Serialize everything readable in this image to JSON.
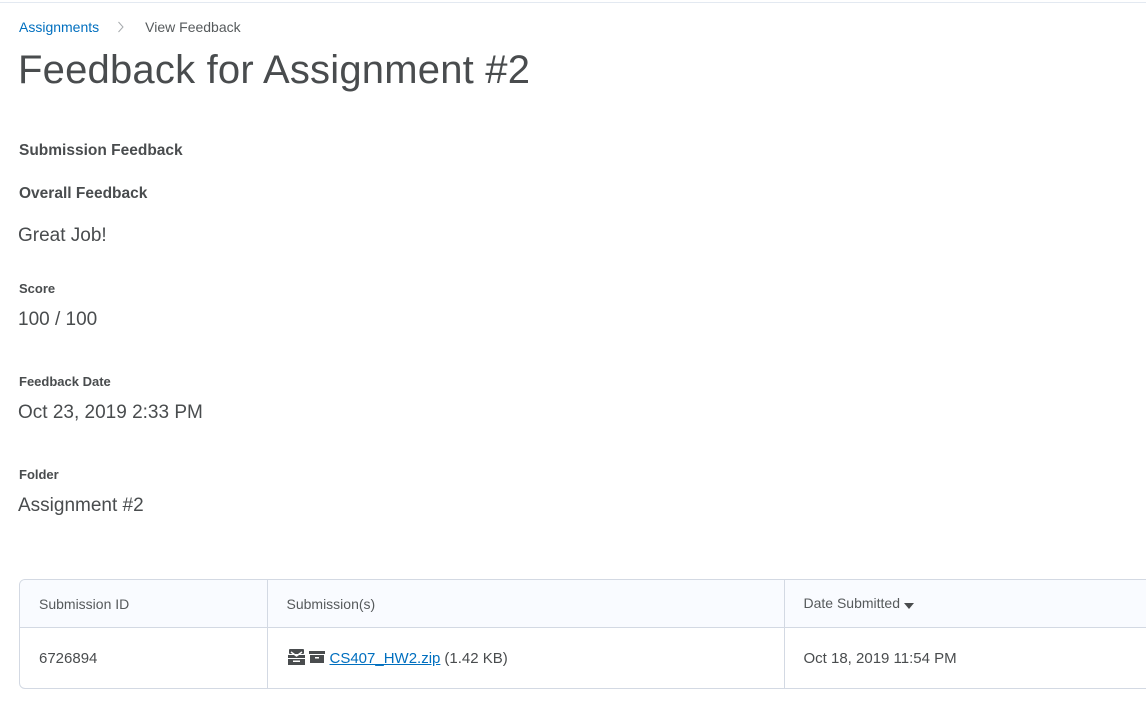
{
  "breadcrumb": {
    "parent": "Assignments",
    "current": "View Feedback"
  },
  "page_title": "Feedback for Assignment #2",
  "sections": {
    "submission_feedback_heading": "Submission Feedback",
    "overall_feedback_label": "Overall Feedback",
    "overall_feedback_value": "Great Job!",
    "score_label": "Score",
    "score_value": "100 / 100",
    "feedback_date_label": "Feedback Date",
    "feedback_date_value": "Oct 23, 2019 2:33 PM",
    "folder_label": "Folder",
    "folder_value": "Assignment #2"
  },
  "table": {
    "headers": [
      "Submission ID",
      "Submission(s)",
      "Date Submitted"
    ],
    "rows": [
      {
        "submission_id": "6726894",
        "file_name": "CS407_HW2.zip",
        "file_size": "(1.42 KB)",
        "date_submitted": "Oct 18, 2019 11:54 PM"
      }
    ],
    "sort_icon": "caret-down-icon"
  },
  "colors": {
    "link": "#006fbf",
    "text": "#494c4e",
    "border": "#d3d9e3",
    "header_bg": "#f9fbff"
  }
}
